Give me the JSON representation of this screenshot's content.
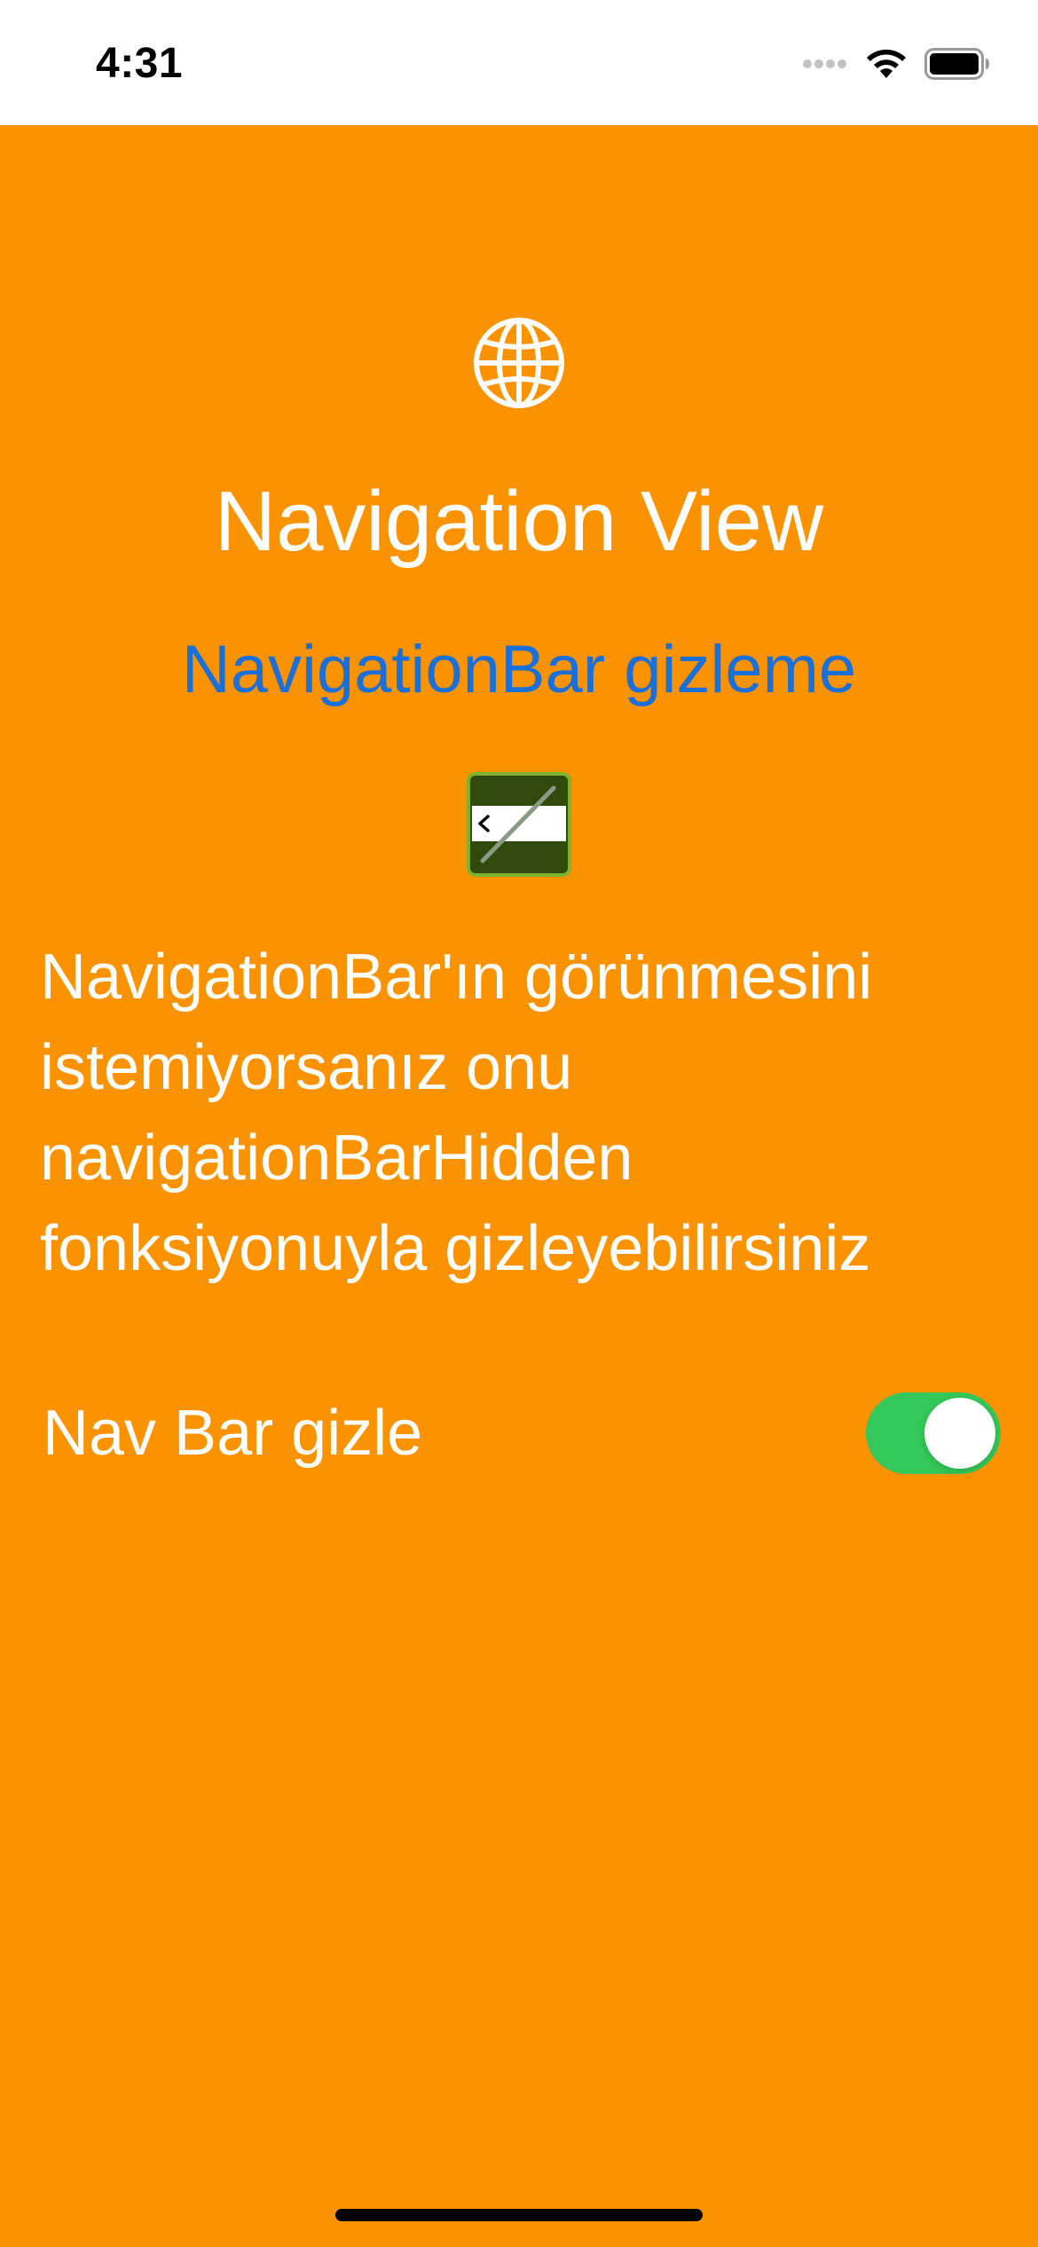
{
  "status_bar": {
    "time": "4:31",
    "icons": [
      "signal-icon",
      "wifi-icon",
      "battery-icon"
    ]
  },
  "screen": {
    "background_color": "#FB9300",
    "icon": "globe-icon",
    "title": "Navigation View",
    "link_text": "NavigationBar gizleme",
    "link_color": "#1A6FD8",
    "image_icon": "navigation-bar-hidden-icon",
    "description": "NavigationBar'ın görünmesini istemiyorsanız onu navigationBarHidden fonksiyonuyla gizleyebilirsiniz",
    "toggle": {
      "label": "Nav Bar gizle",
      "on": true,
      "on_color": "#34C759"
    }
  }
}
